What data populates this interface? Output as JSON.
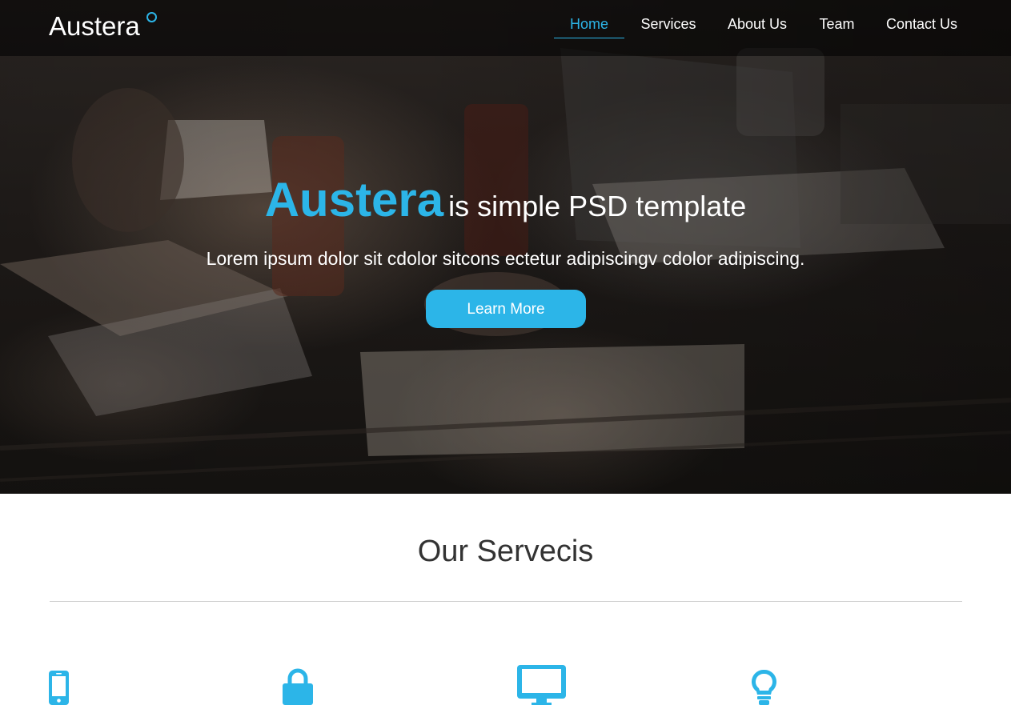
{
  "brand": {
    "name": "Austera",
    "accent_color": "#2cb5e8"
  },
  "nav": {
    "items": [
      {
        "label": "Home",
        "active": true
      },
      {
        "label": "Services",
        "active": false
      },
      {
        "label": "About Us",
        "active": false
      },
      {
        "label": "Team",
        "active": false
      },
      {
        "label": "Contact Us",
        "active": false
      }
    ]
  },
  "hero": {
    "title_brand": "Austera",
    "title_rest": "is simple PSD template",
    "subtitle": "Lorem ipsum dolor sit cdolor sitcons ectetur adipiscingv cdolor adipiscing.",
    "cta_label": "Learn More"
  },
  "services": {
    "title": "Our Servecis",
    "icons": [
      "mobile-phone-icon",
      "lock-icon",
      "monitor-icon",
      "lightbulb-icon"
    ]
  }
}
